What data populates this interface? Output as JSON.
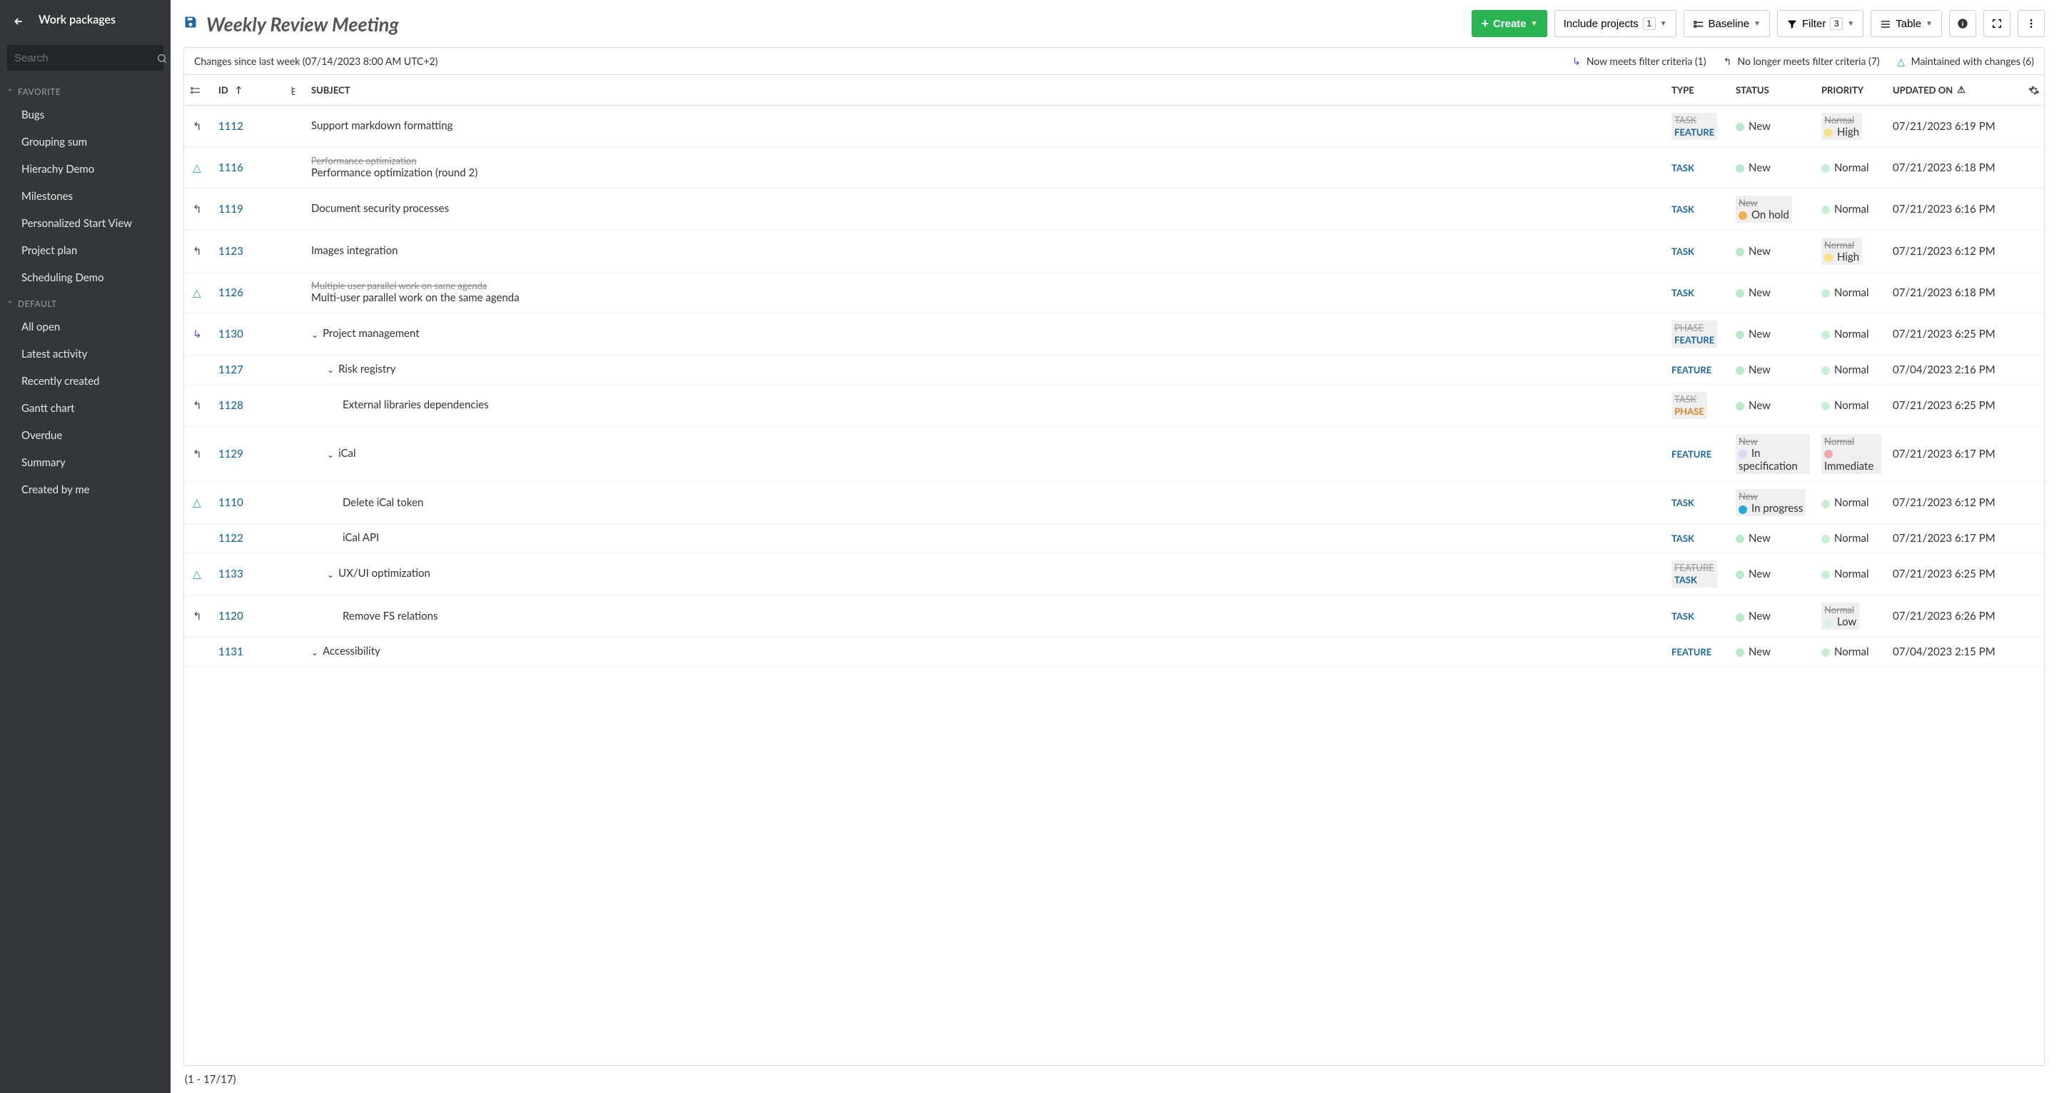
{
  "sidebar": {
    "title": "Work packages",
    "search_placeholder": "Search",
    "sections": [
      {
        "label": "FAVORITE",
        "items": [
          "Bugs",
          "Grouping sum",
          "Hierachy Demo",
          "Milestones",
          "Personalized Start View",
          "Project plan",
          "Scheduling Demo"
        ]
      },
      {
        "label": "DEFAULT",
        "items": [
          "All open",
          "Latest activity",
          "Recently created",
          "Gantt chart",
          "Overdue",
          "Summary",
          "Created by me"
        ]
      }
    ]
  },
  "toolbar": {
    "view_title": "Weekly Review Meeting",
    "create_label": "Create",
    "include_projects_label": "Include projects",
    "include_projects_count": "1",
    "baseline_label": "Baseline",
    "filter_label": "Filter",
    "filter_count": "3",
    "table_label": "Table"
  },
  "baseline_bar": {
    "text": "Changes since last week (07/14/2023 8:00 AM UTC+2)",
    "meets": "Now meets filter criteria (1)",
    "nolonger": "No longer meets filter criteria (7)",
    "maintained": "Maintained with changes (6)"
  },
  "columns": {
    "id": "ID",
    "subject": "SUBJECT",
    "type": "TYPE",
    "status": "STATUS",
    "priority": "PRIORITY",
    "updated": "UPDATED ON"
  },
  "status_colors": {
    "New": "#b8eacb",
    "On hold": "#f2b34d",
    "In specification": "#d6d9f5",
    "In progress": "#2aa7d6"
  },
  "priority_colors": {
    "Normal": "#c6f0d4",
    "High": "#f7e18b",
    "Low": "#d9f2e0",
    "Immediate": "#f2a5a5"
  },
  "rows": [
    {
      "icon": "nolonger",
      "id": "1112",
      "indent": 0,
      "chev": false,
      "subject": "Support markdown formatting",
      "type_old": "TASK",
      "type": "FEATURE",
      "status": "New",
      "prio_old": "Normal",
      "prio": "High",
      "updated": "07/21/2023 6:19 PM"
    },
    {
      "icon": "maint",
      "id": "1116",
      "indent": 0,
      "chev": false,
      "subject_old": "Performance optimization",
      "subject": "Performance optimization (round 2)",
      "type": "TASK",
      "status": "New",
      "prio": "Normal",
      "updated": "07/21/2023 6:18 PM"
    },
    {
      "icon": "nolonger",
      "id": "1119",
      "indent": 0,
      "chev": false,
      "subject": "Document security processes",
      "type": "TASK",
      "status_old": "New",
      "status": "On hold",
      "prio": "Normal",
      "updated": "07/21/2023 6:16 PM"
    },
    {
      "icon": "nolonger",
      "id": "1123",
      "indent": 0,
      "chev": false,
      "subject": "Images integration",
      "type": "TASK",
      "status": "New",
      "prio_old": "Normal",
      "prio": "High",
      "updated": "07/21/2023 6:12 PM"
    },
    {
      "icon": "maint",
      "id": "1126",
      "indent": 0,
      "chev": false,
      "subject_old": "Multiple user parallel work on same agenda",
      "subject": "Multi-user parallel work on the same agenda",
      "type": "TASK",
      "status": "New",
      "prio": "Normal",
      "updated": "07/21/2023 6:18 PM"
    },
    {
      "icon": "meets",
      "id": "1130",
      "indent": 0,
      "chev": true,
      "subject": "Project management",
      "type_old": "PHASE",
      "type": "FEATURE",
      "status": "New",
      "prio": "Normal",
      "updated": "07/21/2023 6:25 PM"
    },
    {
      "icon": "",
      "id": "1127",
      "indent": 1,
      "chev": true,
      "subject": "Risk registry",
      "type": "FEATURE",
      "status": "New",
      "prio": "Normal",
      "updated": "07/04/2023 2:16 PM"
    },
    {
      "icon": "nolonger",
      "id": "1128",
      "indent": 2,
      "chev": false,
      "subject": "External libraries dependencies",
      "type_old": "TASK",
      "type": "PHASE",
      "status": "New",
      "prio": "Normal",
      "updated": "07/21/2023 6:25 PM"
    },
    {
      "icon": "nolonger",
      "id": "1129",
      "indent": 1,
      "chev": true,
      "subject": "iCal",
      "type": "FEATURE",
      "status_old": "New",
      "status": "In specification",
      "prio_old": "Normal",
      "prio": "Immediate",
      "updated": "07/21/2023 6:17 PM"
    },
    {
      "icon": "maint",
      "id": "1110",
      "indent": 2,
      "chev": false,
      "subject": "Delete iCal token",
      "type": "TASK",
      "status_old": "New",
      "status": "In progress",
      "prio": "Normal",
      "updated": "07/21/2023 6:12 PM"
    },
    {
      "icon": "",
      "id": "1122",
      "indent": 2,
      "chev": false,
      "subject": "iCal API",
      "type": "TASK",
      "status": "New",
      "prio": "Normal",
      "updated": "07/21/2023 6:17 PM"
    },
    {
      "icon": "maint",
      "id": "1133",
      "indent": 1,
      "chev": true,
      "subject": "UX/UI optimization",
      "type_old": "FEATURE",
      "type": "TASK",
      "status": "New",
      "prio": "Normal",
      "updated": "07/21/2023 6:25 PM"
    },
    {
      "icon": "nolonger",
      "id": "1120",
      "indent": 2,
      "chev": false,
      "subject": "Remove FS relations",
      "type": "TASK",
      "status": "New",
      "prio_old": "Normal",
      "prio": "Low",
      "updated": "07/21/2023 6:26 PM"
    },
    {
      "icon": "",
      "id": "1131",
      "indent": 0,
      "chev": true,
      "subject": "Accessibility",
      "type": "FEATURE",
      "status": "New",
      "prio": "Normal",
      "updated": "07/04/2023 2:15 PM"
    }
  ],
  "footer": {
    "pagination": "(1 - 17/17)"
  }
}
